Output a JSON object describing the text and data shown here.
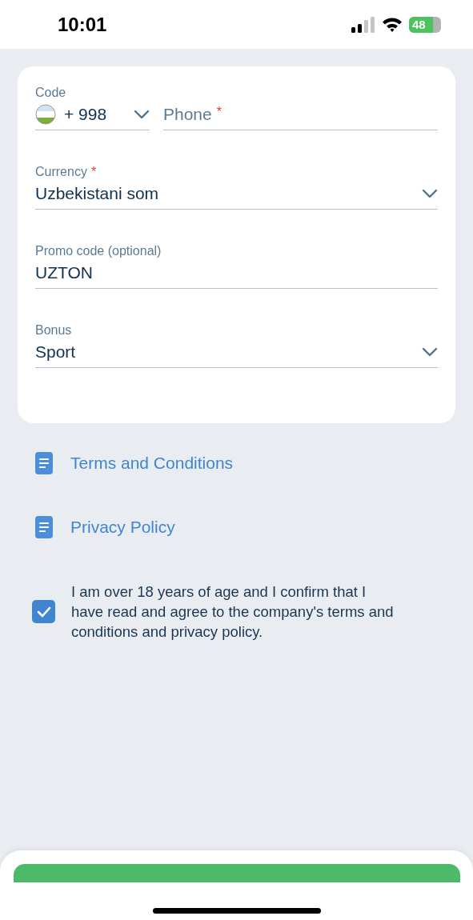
{
  "status_bar": {
    "time": "10:01",
    "battery": "48"
  },
  "form": {
    "fields": [
      {
        "kind": "code",
        "label": "Code",
        "value": "+ 998"
      },
      {
        "kind": "text",
        "placeholder": "Phone",
        "required_mark": "*"
      },
      {
        "kind": "select",
        "label": "Currency",
        "required_mark": "*",
        "value": "Uzbekistani som"
      },
      {
        "kind": "text",
        "label": "Promo code (optional)",
        "value": "UZTON"
      },
      {
        "kind": "select",
        "label": "Bonus",
        "value": "Sport"
      }
    ]
  },
  "links": [
    "Terms and Conditions",
    "Privacy Policy"
  ],
  "consent": {
    "checked": true,
    "text": "I am over 18 years of age and I confirm that I have read and agree to the company's terms and conditions and privacy policy."
  }
}
